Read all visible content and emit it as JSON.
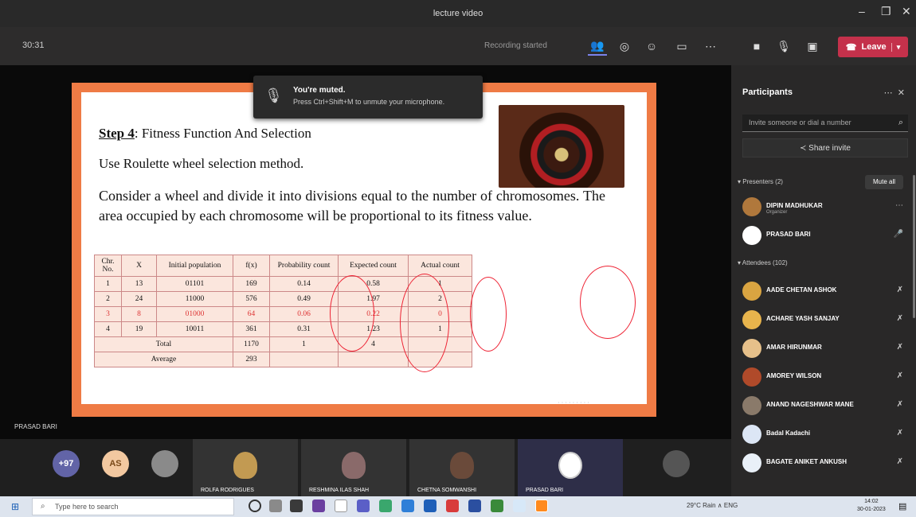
{
  "window": {
    "title": "lecture video"
  },
  "toolbar": {
    "time": "30:31",
    "status": "Recording started",
    "leave_label": "Leave",
    "leave_color": "#c4314b"
  },
  "toast": {
    "title": "You're muted.",
    "message": "Press Ctrl+Shift+M to unmute your microphone."
  },
  "slide": {
    "step_label": "Step 4",
    "step_title": ": Fitness Function And Selection",
    "line1": "Use Roulette wheel selection method.",
    "paragraph": "Consider a wheel and divide it into divisions equal to the number of chromosomes. The area occupied by each chromosome will be proportional to its fitness value.",
    "table": {
      "headers": [
        "Chr. No.",
        "X",
        "Initial population",
        "f(x)",
        "Probability count",
        "Expected count",
        "Actual count"
      ],
      "rows": [
        [
          "1",
          "13",
          "01101",
          "169",
          "0.14",
          "0.58",
          "1"
        ],
        [
          "2",
          "24",
          "11000",
          "576",
          "0.49",
          "1.97",
          "2"
        ],
        [
          "3",
          "8",
          "01000",
          "64",
          "0.06",
          "0.22",
          "0"
        ],
        [
          "4",
          "19",
          "10011",
          "361",
          "0.31",
          "1.23",
          "1"
        ]
      ],
      "total": {
        "label": "Total",
        "fx": "1170",
        "prob": "1",
        "expected": "4"
      },
      "average": {
        "label": "Average",
        "fx": "293"
      }
    },
    "accent_color": "#ef7b45"
  },
  "presenter_tag": "PRASAD BARI",
  "strip": {
    "bubbles": [
      {
        "text": "+97",
        "color": "#6264a7"
      },
      {
        "text": "AS",
        "color": "#f2c8a0"
      }
    ],
    "tiles": [
      {
        "name": "ROLFA RODRIGUES"
      },
      {
        "name": "RESHMINA ILAS SHAH"
      },
      {
        "name": "CHETNA SOMWANSHI"
      },
      {
        "name": "PRASAD BARI"
      }
    ]
  },
  "panel": {
    "title": "Participants",
    "search_placeholder": "Invite someone or dial a number",
    "share_label": "Share invite",
    "presenters_label": "Presenters (2)",
    "mute_all": "Mute all",
    "attendees_label": "Attendees (102)",
    "presenters": [
      {
        "name": "DIPIN MADHUKAR",
        "sub": "Organizer"
      },
      {
        "name": "PRASAD BARI",
        "sub": ""
      }
    ],
    "attendees": [
      {
        "name": "AADE CHETAN ASHOK"
      },
      {
        "name": "ACHARE YASH SANJAY"
      },
      {
        "name": "AMAR HIRUNMAR"
      },
      {
        "name": "AMOREY WILSON"
      },
      {
        "name": "ANAND NAGESHWAR MANE"
      },
      {
        "name": "Badal Kadachi"
      },
      {
        "name": "BAGATE ANIKET ANKUSH"
      }
    ]
  },
  "taskbar": {
    "search_placeholder": "Type here to search",
    "tray": "29°C Rain  ∧  ENG",
    "time": "14:02",
    "date": "30-01-2023"
  }
}
